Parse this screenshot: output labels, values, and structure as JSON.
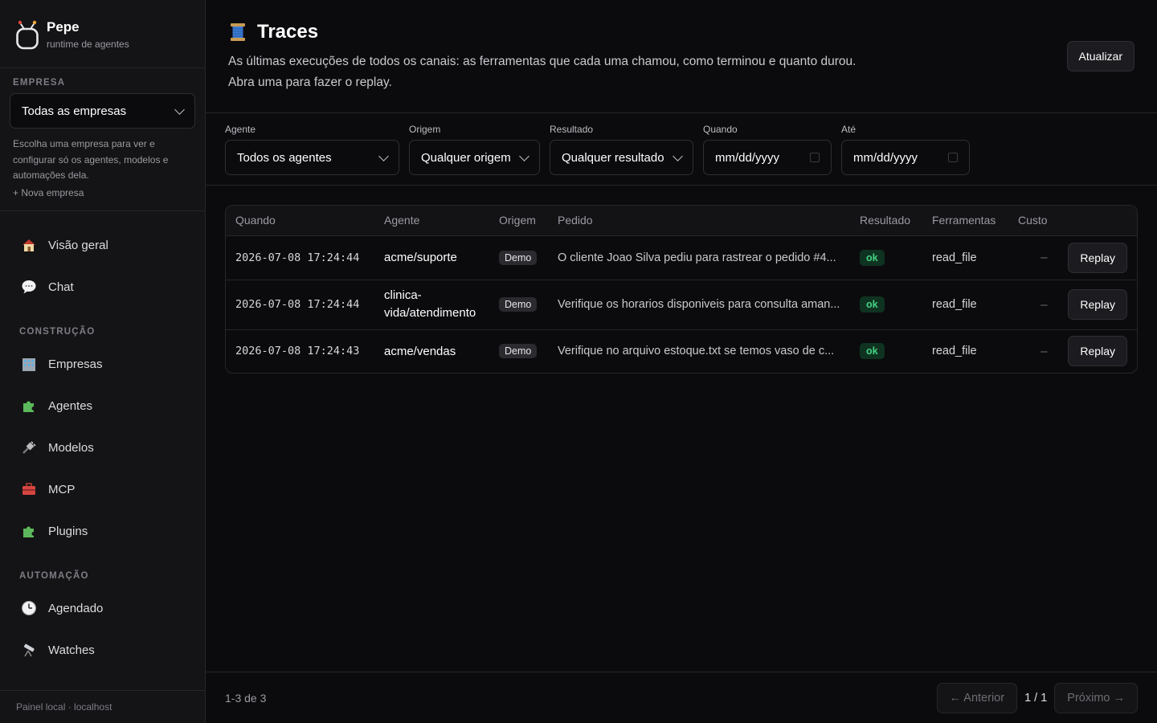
{
  "brand": {
    "name": "Pepe",
    "subtitle": "runtime de agentes"
  },
  "company": {
    "label": "EMPRESA",
    "selected": "Todas as empresas",
    "hint": "Escolha uma empresa para ver e configurar só os agentes, modelos e automações dela.",
    "new_link": "+ Nova empresa"
  },
  "nav": {
    "top": [
      {
        "label": "Visão geral",
        "icon": "house-icon"
      },
      {
        "label": "Chat",
        "icon": "speech-bubble-icon"
      }
    ],
    "construcao_label": "CONSTRUÇÃO",
    "construcao": [
      {
        "label": "Empresas",
        "icon": "office-building-icon"
      },
      {
        "label": "Agentes",
        "icon": "puzzle-icon"
      },
      {
        "label": "Modelos",
        "icon": "plug-icon"
      },
      {
        "label": "MCP",
        "icon": "toolbox-icon"
      },
      {
        "label": "Plugins",
        "icon": "puzzle-icon"
      }
    ],
    "automacao_label": "AUTOMAÇÃO",
    "automacao": [
      {
        "label": "Agendado",
        "icon": "clock-icon"
      },
      {
        "label": "Watches",
        "icon": "telescope-icon"
      }
    ]
  },
  "sidebar_footer": "Painel local · localhost",
  "header": {
    "title": "Traces",
    "icon": "thread-spool-icon",
    "description": "As últimas execuções de todos os canais: as ferramentas que cada uma chamou, como terminou e quanto durou. Abra uma para fazer o replay.",
    "refresh_label": "Atualizar"
  },
  "filters": {
    "agent": {
      "label": "Agente",
      "value": "Todos os agentes"
    },
    "origin": {
      "label": "Origem",
      "value": "Qualquer origem"
    },
    "result": {
      "label": "Resultado",
      "value": "Qualquer resultado"
    },
    "from": {
      "label": "Quando",
      "value": "mm/dd/yyyy"
    },
    "to": {
      "label": "Até",
      "value": "mm/dd/yyyy"
    }
  },
  "table": {
    "columns": [
      "Quando",
      "Agente",
      "Origem",
      "Pedido",
      "Resultado",
      "Ferramentas",
      "Custo"
    ],
    "rows": [
      {
        "when": "2026-07-08 17:24:44",
        "agent": "acme/suporte",
        "origin": "Demo",
        "request": "O cliente Joao Silva pediu para rastrear o pedido #4...",
        "result": "ok",
        "tools": "read_file",
        "cost": "–",
        "action": "Replay"
      },
      {
        "when": "2026-07-08 17:24:44",
        "agent": "clinica-vida/atendimento",
        "origin": "Demo",
        "request": "Verifique os horarios disponiveis para consulta aman...",
        "result": "ok",
        "tools": "read_file",
        "cost": "–",
        "action": "Replay"
      },
      {
        "when": "2026-07-08 17:24:43",
        "agent": "acme/vendas",
        "origin": "Demo",
        "request": "Verifique no arquivo estoque.txt se temos vaso de c...",
        "result": "ok",
        "tools": "read_file",
        "cost": "–",
        "action": "Replay"
      }
    ]
  },
  "pagination": {
    "count": "1-3 de 3",
    "prev": "← Anterior",
    "page": "1 / 1",
    "next": "Próximo →"
  }
}
